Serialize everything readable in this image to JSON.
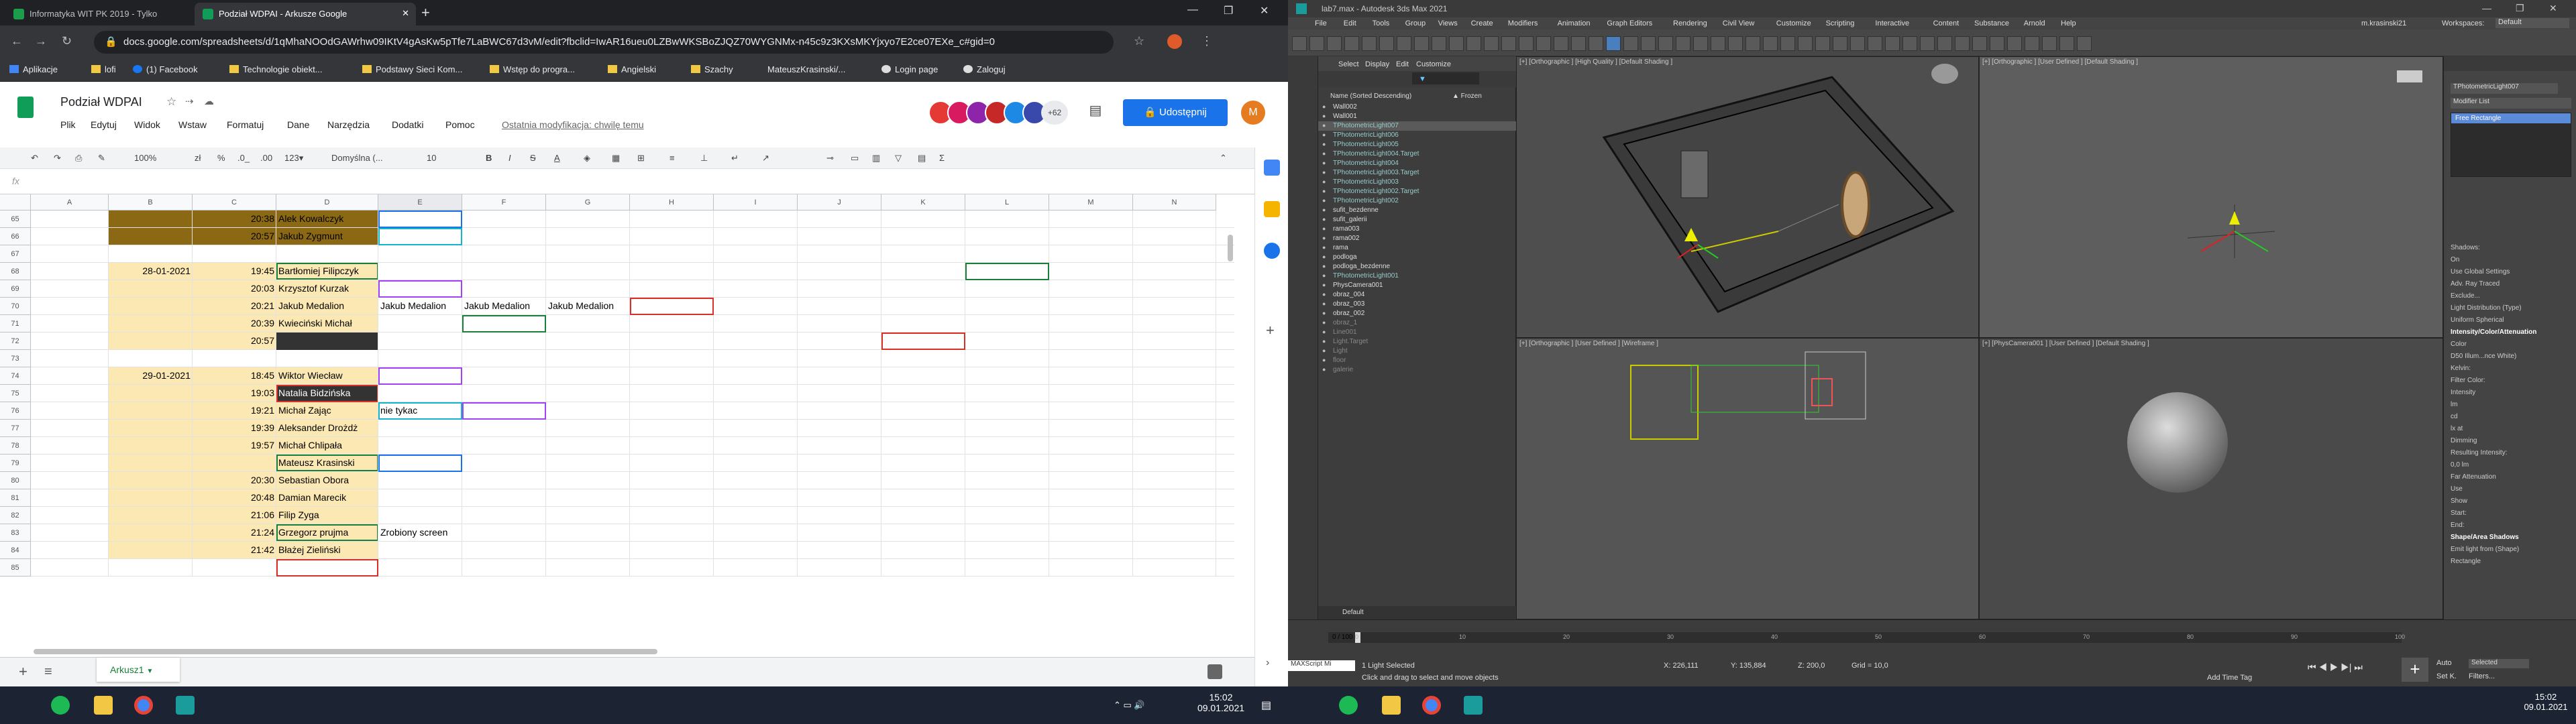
{
  "browser": {
    "tabs": [
      {
        "label": "Informatyka WIT PK 2019 - Tylko",
        "color": "#1b9e4b"
      },
      {
        "label": "Podział WDPAI - Arkusze Google",
        "color": "#0f9d58"
      }
    ],
    "new_tab": "+",
    "url": "docs.google.com/spreadsheets/d/1qMhaNOOdGAWrhw09IKtV4gAsKw5pTfe7LaBWC67d3vM/edit?fbclid=IwAR16ueu0LZBwWKSBoZJQZ70WYGNMx-n45c9z3KXsMKYjxyo7E2ce07EXe_c#gid=0",
    "bookmarks": [
      "Aplikacje",
      "lofi",
      "(1) Facebook",
      "Technologie obiekt...",
      "Podstawy Sieci Kom...",
      "Wstęp do progra...",
      "Angielski",
      "Szachy",
      "MateuszKrasinski/...",
      "Login page",
      "Zaloguj"
    ]
  },
  "sheet": {
    "title": "Podział WDPAI",
    "menu": [
      "Plik",
      "Edytuj",
      "Widok",
      "Wstaw",
      "Formatuj",
      "Dane",
      "Narzędzia",
      "Dodatki",
      "Pomoc"
    ],
    "last_edit": "Ostatnia modyfikacja: chwilę temu",
    "avatars_more": "+62",
    "share": "Udostępnij",
    "user_initial": "M",
    "toolbar": {
      "zoom": "100%",
      "currency": "zł",
      "percent": "%",
      "dec1": ".0_",
      "dec2": ".00",
      "fmt": "123▾",
      "font": "Domyślna (...",
      "size": "10",
      "bold": "B",
      "italic": "I",
      "strike": "S",
      "color": "A"
    },
    "fx": "fx",
    "columns": [
      "A",
      "B",
      "C",
      "D",
      "E",
      "F",
      "G",
      "H",
      "I",
      "J",
      "K",
      "L",
      "M",
      "N"
    ],
    "rows": [
      "65",
      "66",
      "67",
      "68",
      "69",
      "70",
      "71",
      "72",
      "73",
      "74",
      "75",
      "76",
      "77",
      "78",
      "79",
      "80",
      "81",
      "82",
      "83",
      "84",
      "85"
    ],
    "cells": {
      "65": {
        "time": "20:38",
        "name": "Alek Kowalczyk"
      },
      "66": {
        "time": "20:57",
        "name": "Jakub Zygmunt"
      },
      "68": {
        "date": "28-01-2021",
        "time": "19:45",
        "name": "Bartłomiej Filipczyk"
      },
      "69": {
        "time": "20:03",
        "name": "Krzysztof Kurzak"
      },
      "70": {
        "time": "20:21",
        "name": "Jakub Medalion",
        "e": "Jakub Medalion",
        "f": "Jakub Medalion",
        "g": "Jakub Medalion"
      },
      "71": {
        "time": "20:39",
        "name": "Kwieciński Michał"
      },
      "72": {
        "time": "20:57",
        "name": ""
      },
      "74": {
        "date": "29-01-2021",
        "time": "18:45",
        "name": "Wiktor Wiecław"
      },
      "75": {
        "time": "19:03",
        "name": "Natalia Bidzińska"
      },
      "76": {
        "time": "19:21",
        "name": "Michał Zając",
        "e": "nie tykac"
      },
      "77": {
        "time": "19:39",
        "name": "Aleksander Drożdż"
      },
      "78": {
        "time": "19:57",
        "name": "Michał Chlipała"
      },
      "79": {
        "time": "",
        "name": "Mateusz Krasinski"
      },
      "80": {
        "time": "20:30",
        "name": "Sebastian Obora"
      },
      "81": {
        "time": "20:48",
        "name": "Damian Marecik"
      },
      "82": {
        "time": "21:06",
        "name": "Filip Zyga"
      },
      "83": {
        "time": "21:24",
        "name": "Grzegorz prujma",
        "e": "Zrobiony screen"
      },
      "84": {
        "time": "21:42",
        "name": "Błażej Zieliński"
      }
    },
    "sheet_tab": "Arkusz1",
    "add_sheet": "+",
    "sheets_list": "≡"
  },
  "windows_taskbar_left": {
    "time": "15:02",
    "date": "09.01.2021"
  },
  "max": {
    "title": "lab7.max - Autodesk 3ds Max 2021",
    "menu": [
      "File",
      "Edit",
      "Tools",
      "Group",
      "Views",
      "Create",
      "Modifiers",
      "Animation",
      "Graph Editors",
      "Rendering",
      "Civil View",
      "Customize",
      "Scripting",
      "Interactive",
      "Content",
      "Substance",
      "Arnold",
      "Help"
    ],
    "user": "m.krasinski21",
    "workspace": "Workspaces:",
    "workspace_value": "Default",
    "scene_tabs": [
      "Select",
      "Display",
      "Edit",
      "Customize"
    ],
    "scene_header": "Name (Sorted Descending)",
    "scene_header2": "▲ Frozen",
    "objects": [
      "Wall002",
      "Wall001",
      "TPhotometricLight007",
      "TPhotometricLight006",
      "TPhotometricLight005",
      "TPhotometricLight004.Target",
      "TPhotometricLight004",
      "TPhotometricLight003.Target",
      "TPhotometricLight003",
      "TPhotometricLight002.Target",
      "TPhotometricLight002",
      "sufit_bezdenne",
      "sufit_galerii",
      "rama003",
      "rama002",
      "rama",
      "podloga",
      "podloga_bezdenne",
      "TPhotometricLight001",
      "PhysCamera001",
      "obraz_004",
      "obraz_003",
      "obraz_002",
      "obraz_1",
      "Line001",
      "Light.Target",
      "Light",
      "floor",
      "galerie"
    ],
    "viewports": [
      "[+] [Orthographic ] [High Quality ] [Default Shading ]",
      "[+] [Orthographic ] [User Defined ] [Default Shading ]",
      "[+] [Orthographic ] [User Defined ] [Wireframe ]",
      "[+] [PhysCamera001 ] [User Defined ] [Default Shading ]"
    ],
    "cmd_object": "TPhotometricLight007",
    "modifier_list": "Modifier List",
    "modifier_item": "Free Rectangle",
    "params": [
      "Shadows:",
      "On",
      "Use Global Settings",
      "Adv. Ray Traced",
      "Exclude...",
      "Light Distribution (Type)",
      "Uniform Spherical",
      "Intensity/Color/Attenuation",
      "Color",
      "D50 Illum...nce White)",
      "Kelvin:",
      "Filter Color:",
      "Intensity",
      "lm",
      "cd",
      "lx at",
      "Dimming",
      "Resulting Intensity:",
      "0,0 lm",
      "Far Attenuation",
      "Use",
      "Show",
      "Start:",
      "End:",
      "Shape/Area Shadows",
      "Emit light from (Shape)",
      "Rectangle"
    ],
    "layer": "Default",
    "frame": "0 / 100",
    "status": "1 Light Selected",
    "prompt": "Click and drag to select and move objects",
    "maxscript": "MAXScript Mi",
    "coords": {
      "x": "X: 226,111",
      "y": "Y: 135,884",
      "z": "Z: 200,0",
      "grid": "Grid = 10,0"
    },
    "add_time_tag": "Add Time Tag",
    "auto": "Auto",
    "selected": "Selected",
    "set_key": "Set K.",
    "filters": "Filters...",
    "timeline_ticks": [
      "0",
      "10",
      "20",
      "30",
      "40",
      "50",
      "60",
      "70",
      "80",
      "90",
      "100"
    ]
  },
  "windows_taskbar_right": {
    "time": "15:02",
    "date": "09.01.2021"
  }
}
